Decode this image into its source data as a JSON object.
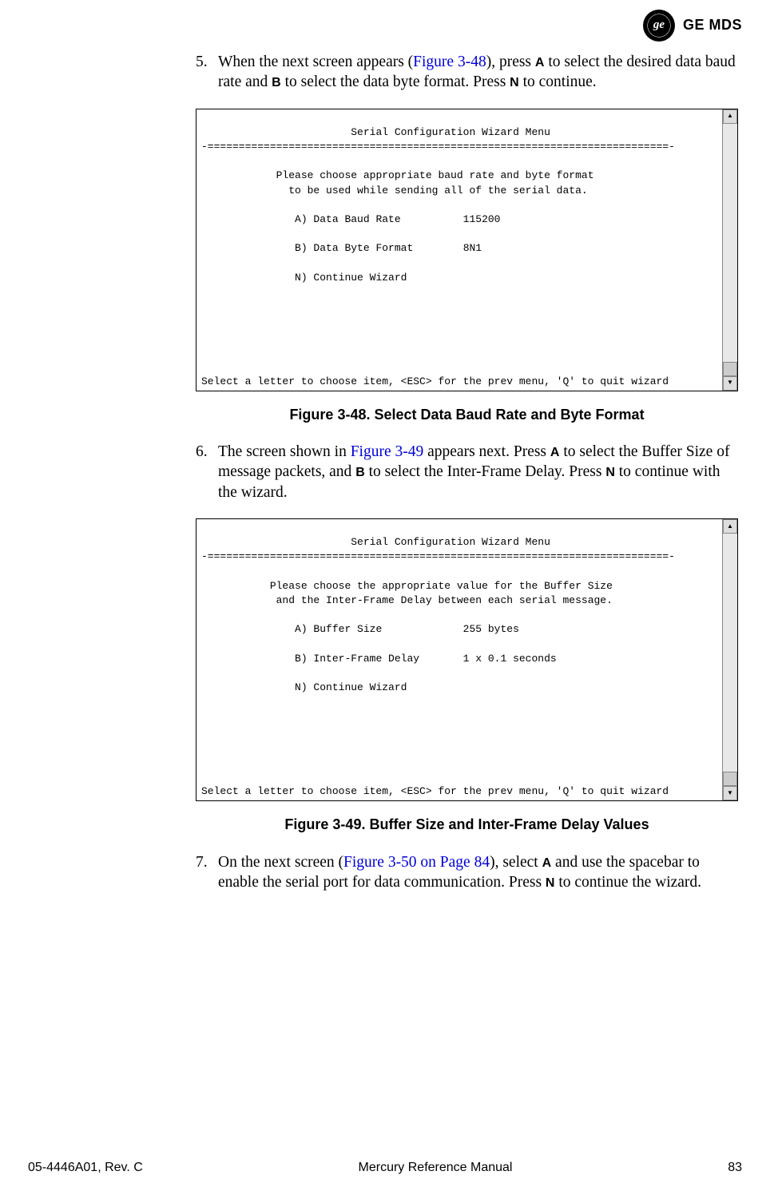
{
  "header": {
    "logo_text": "GE MDS",
    "monogram": "ge"
  },
  "steps": [
    {
      "num": "5.",
      "text_pre": "When the next screen appears (",
      "link": "Figure 3-48",
      "text_mid1": "), press ",
      "key1": "A",
      "text_mid2": " to select the desired data baud rate and ",
      "key2": "B",
      "text_mid3": " to select the data byte format. Press ",
      "key3": "N",
      "text_end": " to continue."
    },
    {
      "num": "6.",
      "text_pre": "The screen shown in ",
      "link": "Figure 3-49",
      "text_mid1": " appears next. Press ",
      "key1": "A",
      "text_mid2": " to select the Buffer Size of message packets, and ",
      "key2": "B",
      "text_mid3": " to select the Inter-Frame Delay. Press ",
      "key3": "N",
      "text_end": " to continue with the wizard."
    },
    {
      "num": "7.",
      "text_pre": "On the next screen (",
      "link": "Figure 3-50 on Page 84",
      "text_mid1": "), select ",
      "key1": "A",
      "text_mid2": " and use the spacebar to enable the serial port for data communication. Press ",
      "key2": "",
      "text_mid3": "",
      "key3": "N",
      "text_end": " to continue the wizard."
    }
  ],
  "terminal1": {
    "title": "Serial Configuration Wizard Menu",
    "rule": "-==========================================================================-",
    "help1": "Please choose appropriate baud rate and byte format",
    "help2": "to be used while sending all of the serial data.",
    "optA_label": "A) Data Baud Rate",
    "optA_value": "115200",
    "optB_label": "B) Data Byte Format",
    "optB_value": "8N1",
    "optN_label": "N) Continue Wizard",
    "footer": "Select a letter to choose item, <ESC> for the prev menu, 'Q' to quit wizard"
  },
  "terminal2": {
    "title": "Serial Configuration Wizard Menu",
    "rule": "-==========================================================================-",
    "help1": "Please choose the appropriate value for the Buffer Size",
    "help2": "and the Inter-Frame Delay between each serial message.",
    "optA_label": "A) Buffer Size",
    "optA_value": "255 bytes",
    "optB_label": "B) Inter-Frame Delay",
    "optB_value": "1 x 0.1 seconds",
    "optN_label": "N) Continue Wizard",
    "footer": "Select a letter to choose item, <ESC> for the prev menu, 'Q' to quit wizard"
  },
  "captions": {
    "fig48": "Figure 3-48. Select Data Baud Rate and Byte Format",
    "fig49": "Figure 3-49. Buffer Size and Inter-Frame Delay Values"
  },
  "page_footer": {
    "left": "05-4446A01, Rev. C",
    "center": "Mercury Reference Manual",
    "right": "83"
  }
}
